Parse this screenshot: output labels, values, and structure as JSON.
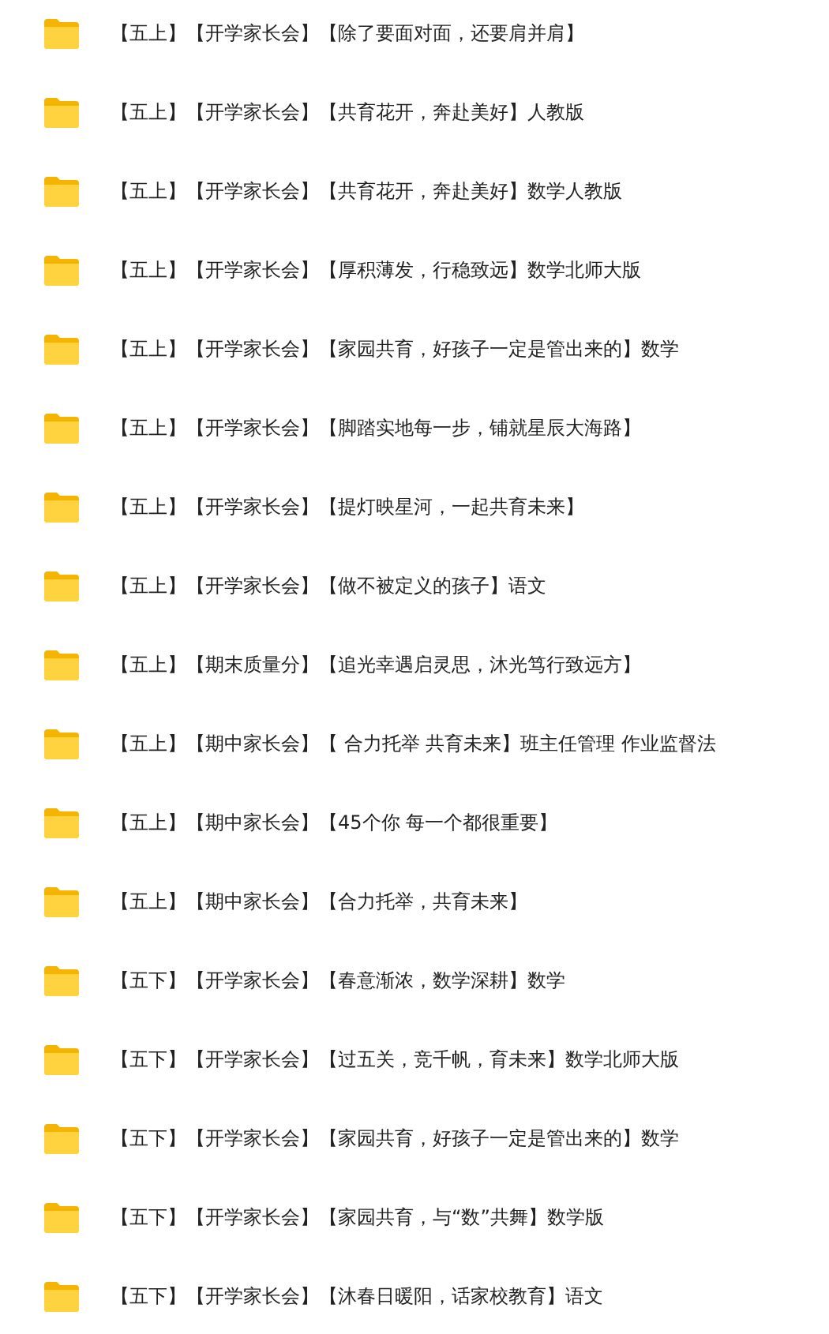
{
  "folders": [
    {
      "name": "【五上】【开学家长会】【除了要面对面，还要肩并肩】"
    },
    {
      "name": "【五上】【开学家长会】【共育花开，奔赴美好】人教版"
    },
    {
      "name": "【五上】【开学家长会】【共育花开，奔赴美好】数学人教版"
    },
    {
      "name": "【五上】【开学家长会】【厚积薄发，行稳致远】数学北师大版"
    },
    {
      "name": "【五上】【开学家长会】【家园共育，好孩子一定是管出来的】数学"
    },
    {
      "name": "【五上】【开学家长会】【脚踏实地每一步，铺就星辰大海路】"
    },
    {
      "name": "【五上】【开学家长会】【提灯映星河，一起共育未来】"
    },
    {
      "name": "【五上】【开学家长会】【做不被定义的孩子】语文"
    },
    {
      "name": "【五上】【期末质量分】【追光幸遇启灵思，沐光笃行致远方】"
    },
    {
      "name": "【五上】【期中家长会】【 合力托举 共育未来】班主任管理 作业监督法"
    },
    {
      "name": "【五上】【期中家长会】【45个你 每一个都很重要】"
    },
    {
      "name": "【五上】【期中家长会】【合力托举，共育未来】"
    },
    {
      "name": "【五下】【开学家长会】【春意渐浓，数学深耕】数学"
    },
    {
      "name": "【五下】【开学家长会】【过五关，竞千帆，育未来】数学北师大版"
    },
    {
      "name": "【五下】【开学家长会】【家园共育，好孩子一定是管出来的】数学"
    },
    {
      "name": "【五下】【开学家长会】【家园共育，与“数”共舞】数学版"
    },
    {
      "name": "【五下】【开学家长会】【沐春日暖阳，话家校教育】语文"
    }
  ]
}
